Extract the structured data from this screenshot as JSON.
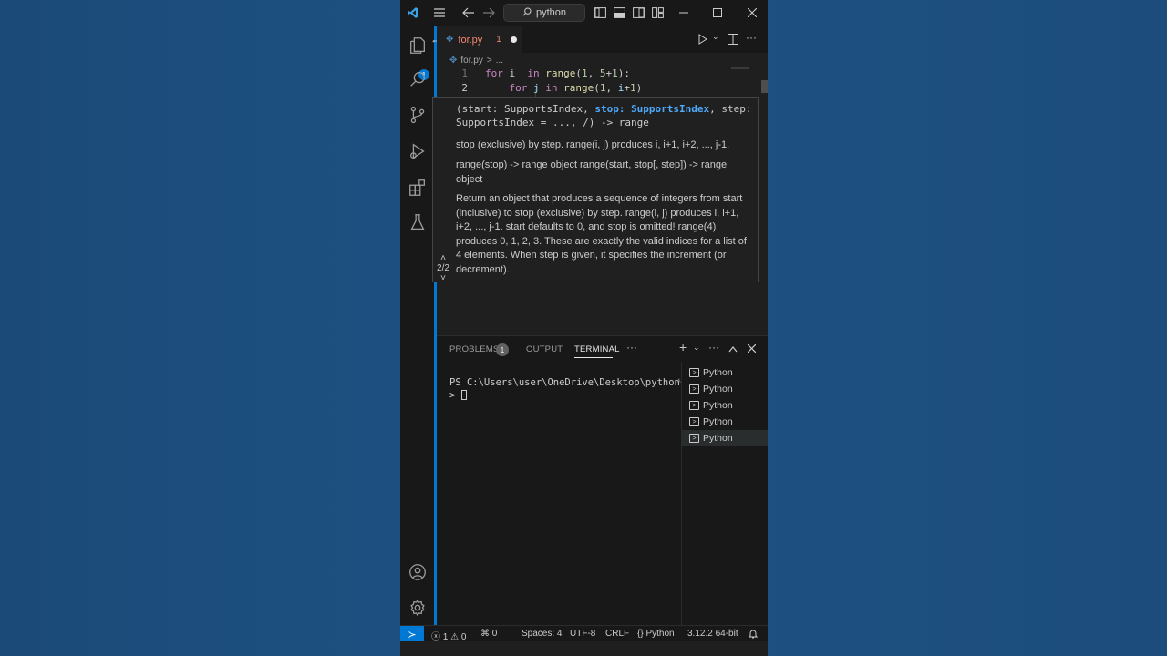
{
  "titlebar": {
    "search_text": "python",
    "icons": [
      "vscode-logo-icon",
      "menu-icon",
      "back-arrow-icon",
      "forward-arrow-icon",
      "toggle-sidebar-icon",
      "toggle-panel-icon",
      "toggle-secondary-sidebar-icon",
      "customize-layout-icon",
      "minimize-icon",
      "maximize-icon",
      "close-icon"
    ]
  },
  "activitybar": {
    "items": [
      "explorer-icon",
      "search-icon",
      "source-control-icon",
      "run-debug-icon",
      "extensions-icon",
      "testing-icon"
    ],
    "explorer_badge": "1",
    "bottom": [
      "account-icon",
      "settings-gear-icon"
    ]
  },
  "editor": {
    "tab": {
      "label": "for.py",
      "problems": "1",
      "dirty": true
    },
    "breadcrumb": {
      "file": "for.py",
      "sep": ">",
      "rest": "..."
    },
    "lines": [
      {
        "num": "1",
        "tokens": [
          [
            "kw",
            "for"
          ],
          [
            "pl",
            " i  "
          ],
          [
            "kw",
            "in"
          ],
          [
            "pl",
            " "
          ],
          [
            "fn",
            "range"
          ],
          [
            "pl",
            "("
          ],
          [
            "nm",
            "1"
          ],
          [
            "pl",
            ", "
          ],
          [
            "nm",
            "5"
          ],
          [
            "pl",
            "+"
          ],
          [
            "nm",
            "1"
          ],
          [
            "pl",
            "):"
          ]
        ]
      },
      {
        "num": "2",
        "tokens": [
          [
            "pl",
            "    "
          ],
          [
            "kw",
            "for"
          ],
          [
            "pl",
            " "
          ],
          [
            "vr",
            "j"
          ],
          [
            "pl",
            " "
          ],
          [
            "kw",
            "in"
          ],
          [
            "pl",
            " "
          ],
          [
            "fn",
            "range"
          ],
          [
            "pl",
            "("
          ],
          [
            "nm",
            "1"
          ],
          [
            "pl",
            ", "
          ],
          [
            "vr",
            "i"
          ],
          [
            "pl",
            "+"
          ],
          [
            "nm",
            "1"
          ],
          [
            "pl",
            ")"
          ]
        ]
      }
    ]
  },
  "hover": {
    "sig_part1": "(start: SupportsIndex, ",
    "sig_hl": "stop: SupportsIndex",
    "sig_part2": ", step: SupportsIndex = ..., /) -> range",
    "doc_1": "stop (exclusive) by step.  range(i, j) produces i, i+1, i+2, ..., j-1.",
    "doc_2": "range(stop) -> range object range(start, stop[, step]) -> range object",
    "doc_3": "Return an object that produces a sequence of integers from start (inclusive) to stop (exclusive) by step. range(i, j) produces i, i+1, i+2, ..., j-1. start defaults to 0, and stop is omitted! range(4) produces 0, 1, 2, 3. These are exactly the valid indices for a list of 4 elements. When step is given, it specifies the increment (or decrement).",
    "overload": "2/2"
  },
  "panel": {
    "tabs": {
      "problems": "PROBLEMS",
      "output": "OUTPUT",
      "terminal": "TERMINAL"
    },
    "problems_count": "1",
    "terminal_line1": "PS C:\\Users\\user\\OneDrive\\Desktop\\python",
    "terminal_line2": ">",
    "terminals": [
      "Python",
      "Python",
      "Python",
      "Python",
      "Python"
    ],
    "active_terminal": 4
  },
  "statusbar": {
    "errors": "1",
    "warnings": "0",
    "ports": "0",
    "spaces": "Spaces: 4",
    "encoding": "UTF-8",
    "eol": "CRLF",
    "language": "Python",
    "interpreter": "3.12.2 64-bit"
  },
  "colors": {
    "accent": "#0078d4",
    "tab_label": "#f48771",
    "background": "#1f1f1f"
  }
}
